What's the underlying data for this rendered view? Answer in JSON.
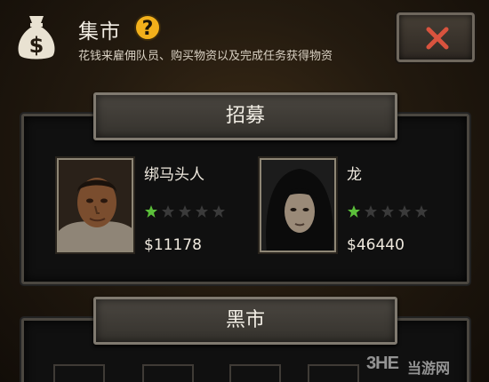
{
  "header": {
    "title": "集市",
    "help_symbol": "?",
    "subtitle": "花钱来雇佣队员、购买物资以及完成任务获得物资",
    "bag_icon": "money-bag-icon",
    "close_icon": "close-x-icon"
  },
  "recruit": {
    "title": "招募",
    "mercs": [
      {
        "name": "绑马头人",
        "price": "$11178",
        "stars_filled": 1,
        "stars_total": 5
      },
      {
        "name": "龙",
        "price": "$46440",
        "stars_filled": 1,
        "stars_total": 5
      }
    ]
  },
  "black_market": {
    "title": "黑市"
  },
  "watermark": {
    "logo": "3HE",
    "text": "当游网"
  },
  "colors": {
    "accent_star": "#5bbf3a",
    "help_yellow": "#f2b01b",
    "close_red": "#d8533e"
  }
}
